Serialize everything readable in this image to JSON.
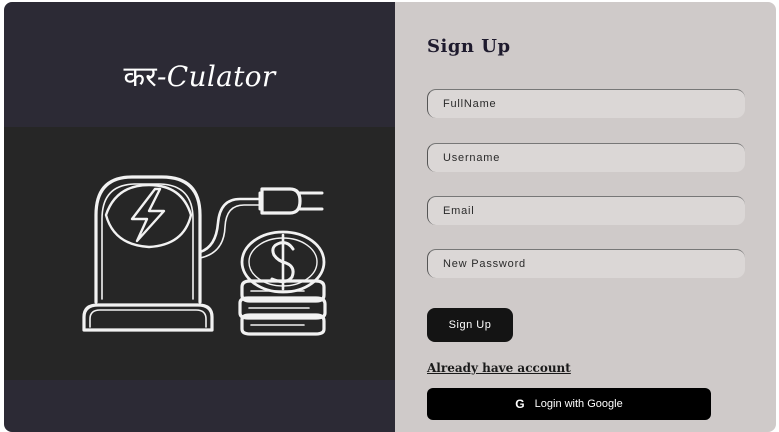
{
  "brand": {
    "devanagari": "कर",
    "latin": "-Culator"
  },
  "illustration": {
    "icon": "ev-charger-with-coins-icon"
  },
  "form": {
    "title": "Sign Up",
    "fullname_placeholder": "FullName",
    "username_placeholder": "Username",
    "email_placeholder": "Email",
    "password_placeholder": "New Password",
    "signup_label": "Sign Up",
    "already_account_label": "Already have account",
    "google_label": "Login with Google",
    "google_icon": "G"
  },
  "colors": {
    "left_panel": "#2c2a35",
    "right_panel": "#cfcac9",
    "button": "#141414"
  }
}
